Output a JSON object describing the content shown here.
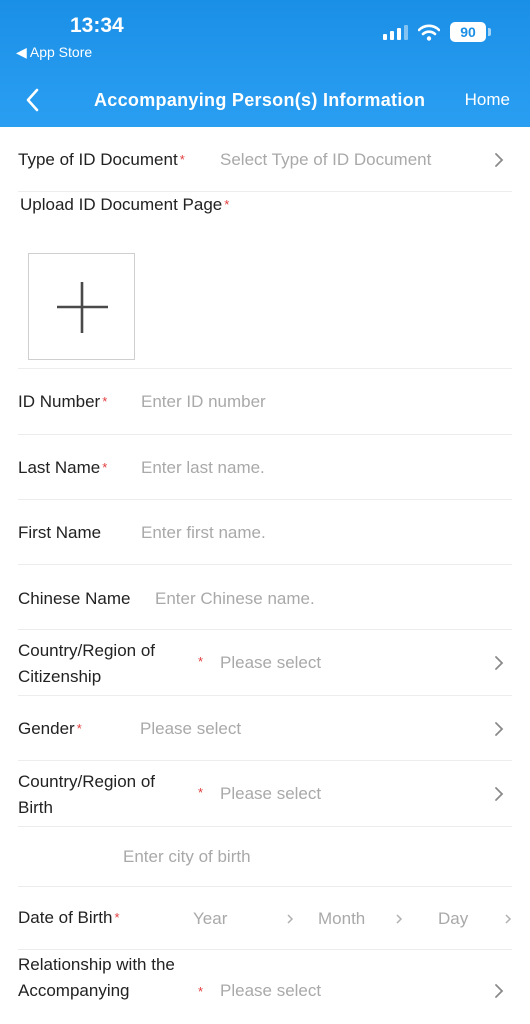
{
  "status_bar": {
    "time": "13:34",
    "back_app": "◀ App Store",
    "battery": "90"
  },
  "nav": {
    "back_icon": "chevron-left-icon",
    "title": "Accompanying Person(s) Information",
    "home": "Home"
  },
  "colors": {
    "header_blue": "#1a8fe6",
    "required_red": "#e23c3c",
    "placeholder_gray": "#a9a9a9"
  },
  "form": {
    "id_type": {
      "label": "Type of ID Document",
      "required": "*",
      "placeholder": "Select Type of ID Document"
    },
    "upload": {
      "label": "Upload ID Document Page",
      "required": "*",
      "icon": "plus-icon"
    },
    "id_number": {
      "label": "ID Number",
      "required": "*",
      "placeholder": "Enter ID number"
    },
    "last_name": {
      "label": "Last Name",
      "required": "*",
      "placeholder": "Enter last name."
    },
    "first_name": {
      "label": "First Name",
      "placeholder": "Enter first name."
    },
    "chinese_name": {
      "label": "Chinese Name",
      "placeholder": "Enter Chinese name."
    },
    "citizenship": {
      "label_line1": "Country/Region of",
      "label_line2": "Citizenship",
      "required": "*",
      "placeholder": "Please select"
    },
    "gender": {
      "label": "Gender",
      "required": "*",
      "placeholder": "Please select"
    },
    "birth_country": {
      "label_line1": "Country/Region of",
      "label_line2": "Birth",
      "required": "*",
      "placeholder": "Please select"
    },
    "birth_city": {
      "placeholder": "Enter city of birth"
    },
    "dob": {
      "label": "Date of Birth",
      "required": "*",
      "year": "Year",
      "month": "Month",
      "day": "Day"
    },
    "relationship": {
      "label_line1": "Relationship with the",
      "label_line2": "Accompanying",
      "required": "*",
      "placeholder": "Please select"
    }
  }
}
